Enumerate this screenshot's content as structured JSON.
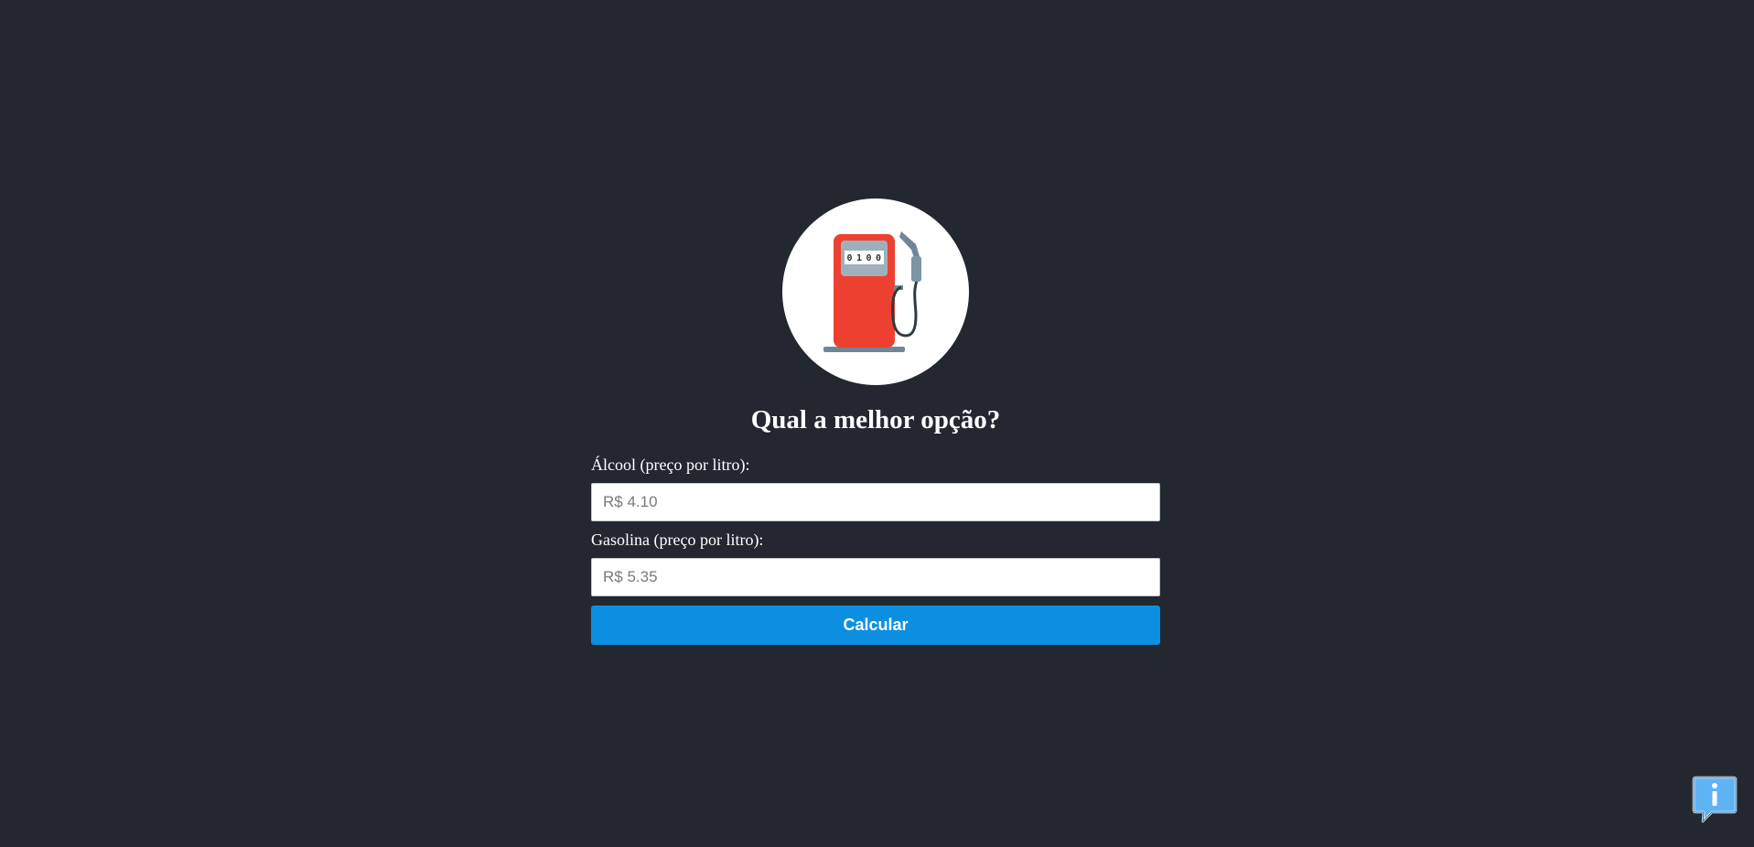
{
  "header": {
    "title": "Qual a melhor opção?"
  },
  "logo": {
    "icon": "gas-pump-icon",
    "counter_text": "0100",
    "colors": {
      "pump_body": "#ee4030",
      "metal": "#6e8796",
      "circle": "#ffffff"
    }
  },
  "form": {
    "alcool_label": "Álcool (preço por litro):",
    "alcool_placeholder": "R$ 4.10",
    "gasolina_label": "Gasolina (preço por litro):",
    "gasolina_placeholder": "R$ 5.35",
    "submit_label": "Calcular"
  },
  "info": {
    "icon": "info-speech-bubble-icon"
  },
  "colors": {
    "background": "#222730",
    "accent": "#0c8fe0"
  }
}
